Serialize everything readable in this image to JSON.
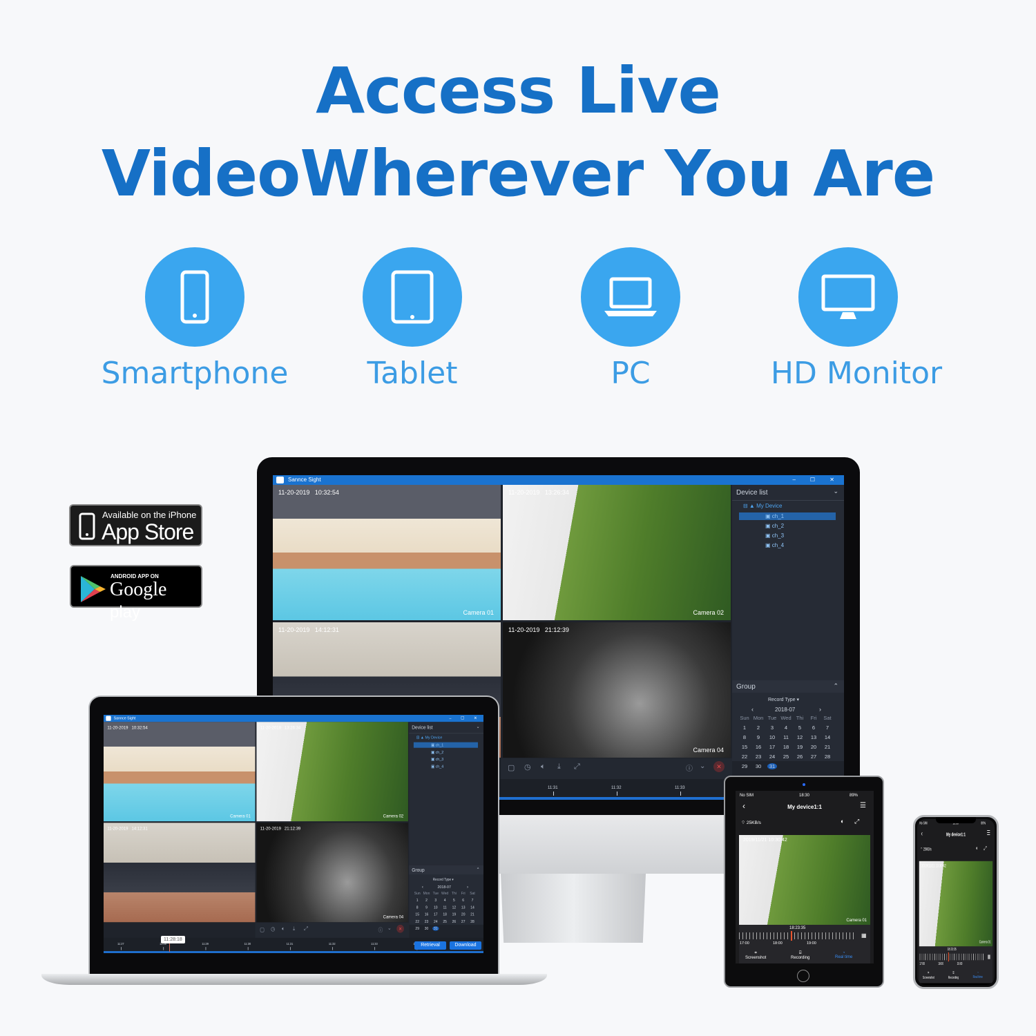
{
  "headline": {
    "line1": "Access Live",
    "line2": "VideoWherever You Are",
    "color": "#1670c6"
  },
  "devices": [
    {
      "label": "Smartphone",
      "icon": "smartphone-icon"
    },
    {
      "label": "Tablet",
      "icon": "tablet-icon"
    },
    {
      "label": "PC",
      "icon": "laptop-icon"
    },
    {
      "label": "HD Monitor",
      "icon": "monitor-icon"
    }
  ],
  "accent": "#3aa6ef",
  "badges": {
    "appstore": {
      "small": "Available on the iPhone",
      "big": "App Store"
    },
    "googleplay": {
      "small": "ANDROID APP ON",
      "big": "Google",
      "big2": "play"
    }
  },
  "desktop_app": {
    "title": "Sannce Sight",
    "cameras": [
      {
        "date": "11-20-2019",
        "time": "10:32:54",
        "label": "Camera 01"
      },
      {
        "date": "11-20-2019",
        "time": "13:26:34",
        "label": "Camera 02"
      },
      {
        "date": "11-20-2019",
        "time": "14:12:31",
        "label": ""
      },
      {
        "date": "11-20-2019",
        "time": "21:12:39",
        "label": "Camera 04"
      }
    ],
    "device_list": {
      "header": "Device list",
      "root": "My Device",
      "channels": [
        "ch_1",
        "ch_2",
        "ch_3",
        "ch_4"
      ],
      "selected": "ch_1"
    },
    "group": {
      "header": "Group",
      "record_type": "Record Type",
      "month": "2018-07",
      "weekdays": [
        "Sun",
        "Mon",
        "Tue",
        "Wed",
        "Thi",
        "Fri",
        "Sat"
      ],
      "days": [
        "1",
        "2",
        "3",
        "4",
        "5",
        "6",
        "7",
        "8",
        "9",
        "10",
        "11",
        "12",
        "13",
        "14",
        "15",
        "16",
        "17",
        "18",
        "19",
        "20",
        "21",
        "22",
        "23",
        "24",
        "25",
        "26",
        "27",
        "28",
        "29",
        "30",
        "31"
      ],
      "selected_day": "31"
    },
    "timeline": {
      "labels": [
        "11:27",
        "11:28",
        "11:29",
        "11:30",
        "11:31",
        "11:32",
        "11:33",
        "11:34"
      ],
      "cursor": "11:28:18"
    },
    "buttons": {
      "retrieval": "Retrieval",
      "download": "Download"
    }
  },
  "mobile_app": {
    "status": {
      "carrier": "No SIM",
      "time": "18:30",
      "battery": "89%"
    },
    "title": "My device1:1",
    "rate": "25KB/s",
    "video_timestamp": "2019/11/21 10:30:42",
    "camera_label": "Camera 01",
    "timeline": {
      "cursor": "18:23:35",
      "labels": [
        "17:00",
        "18:00",
        "19:00"
      ]
    },
    "actions": [
      {
        "label": "Screenshot"
      },
      {
        "label": "Recording"
      },
      {
        "label": "Real time",
        "active": true
      }
    ]
  }
}
